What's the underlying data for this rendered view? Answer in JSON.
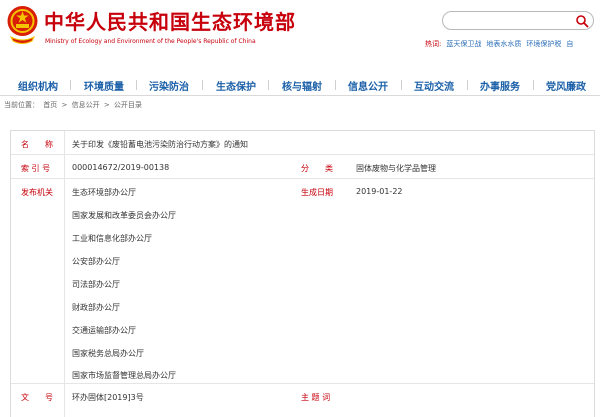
{
  "header": {
    "site_title": "中华人民共和国生态环境部",
    "site_subtitle": "Ministry of Ecology and Environment of the People's Republic of China",
    "hot_label": "热词:",
    "hot_links": [
      "蓝天保卫战",
      "地表水水质",
      "环境保护税",
      "自"
    ],
    "brand_color": "#c7000b"
  },
  "nav": {
    "items": [
      "组织机构",
      "环境质量",
      "污染防治",
      "生态保护",
      "核与辐射",
      "信息公开",
      "互动交流",
      "办事服务",
      "党风廉政"
    ]
  },
  "breadcrumb": {
    "prefix": "当前位置：",
    "items": [
      "首页",
      "信息公开",
      "公开目录"
    ],
    "separator": ">"
  },
  "document": {
    "name_label": "名　　称",
    "name_value": "关于印发《废铅蓄电池污染防治行动方案》的通知",
    "index_label": "索 引 号",
    "index_value": "000014672/2019-00138",
    "category_label": "分　　类",
    "category_value": "固体废物与化学品管理",
    "issuer_label": "发布机关",
    "issuers": [
      "生态环境部办公厅",
      "国家发展和改革委员会办公厅",
      "工业和信息化部办公厅",
      "公安部办公厅",
      "司法部办公厅",
      "财政部办公厅",
      "交通运输部办公厅",
      "国家税务总局办公厅",
      "国家市场监督管理总局办公厅"
    ],
    "date_label": "生成日期",
    "date_value": "2019-01-22",
    "doc_no_label": "文　　号",
    "doc_no_value": "环办固体[2019]3号",
    "subject_label": "主 题 词",
    "subject_value": ""
  }
}
